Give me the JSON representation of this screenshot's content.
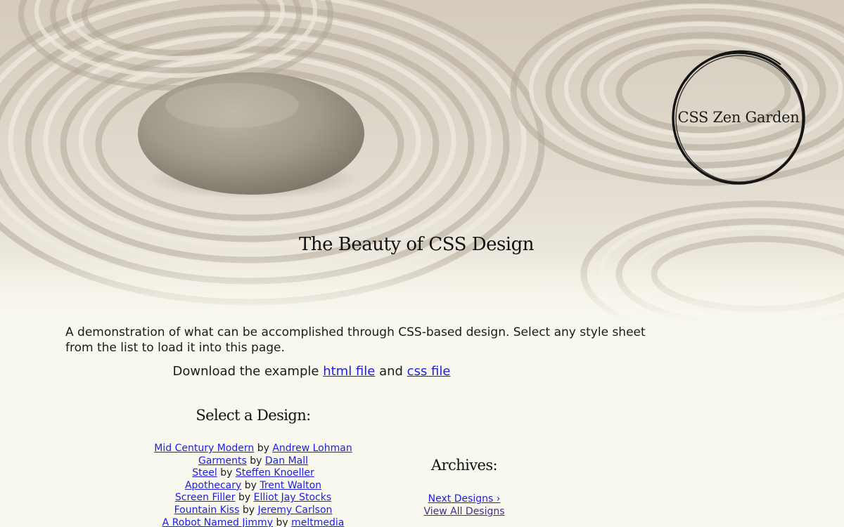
{
  "header": {
    "site_title": "CSS Zen Garden",
    "tagline": "The Beauty of CSS Design"
  },
  "intro": {
    "text": "A demonstration of what can be accomplished through CSS-based design. Select any style sheet from the list to load it into this page.",
    "download_prefix": "Download the example",
    "html_link": "html file",
    "conjunction": "and",
    "css_link": "css file"
  },
  "design_select": {
    "heading": "Select a Design:",
    "by_word": "by",
    "designs": [
      {
        "name": "Mid Century Modern",
        "author": "Andrew Lohman"
      },
      {
        "name": "Garments",
        "author": "Dan Mall"
      },
      {
        "name": "Steel",
        "author": "Steffen Knoeller"
      },
      {
        "name": "Apothecary",
        "author": "Trent Walton"
      },
      {
        "name": "Screen Filler",
        "author": "Elliot Jay Stocks"
      },
      {
        "name": "Fountain Kiss",
        "author": "Jeremy Carlson"
      },
      {
        "name": "A Robot Named Jimmy",
        "author": "meltmedia"
      }
    ]
  },
  "archives": {
    "heading": "Archives:",
    "next_label": "Next Designs ›",
    "view_all_label": "View All Designs"
  },
  "colors": {
    "page_bg": "#f9f8ee",
    "link": "#1d1de2",
    "visited_link": "#4a2a8a",
    "sand": "#d9d2c5"
  }
}
